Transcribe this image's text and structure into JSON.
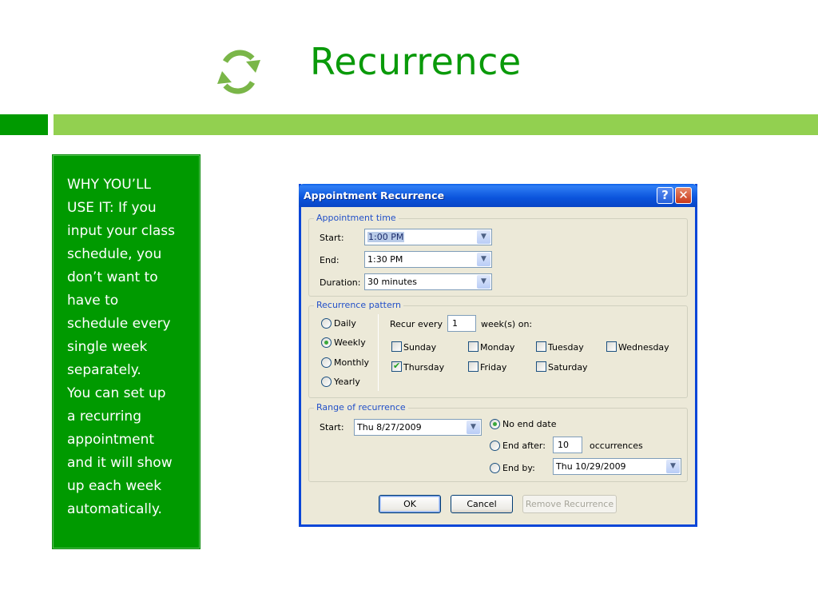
{
  "slide": {
    "title": "Recurrence",
    "title_icon": "recurrence-cycle-icon",
    "colors": {
      "title": "#0a9a0a",
      "bar_dark": "#009a00",
      "bar_light": "#92d050",
      "box": "#009a00"
    },
    "why_box_text": "WHY YOU’LL\nUSE IT: If you\ninput your class\nschedule, you\ndon’t want to\nhave to\nschedule every\nsingle week\nseparately.\nYou can set up\na recurring\nappointment\nand it will show\nup each week\nautomatically."
  },
  "dialog": {
    "title": "Appointment Recurrence",
    "help_label": "?",
    "close_label": "✕",
    "appointment_time": {
      "legend": "Appointment time",
      "start_label": "Start:",
      "start_value": "1:00 PM",
      "end_label": "End:",
      "end_value": "1:30 PM",
      "duration_label": "Duration:",
      "duration_value": "30 minutes"
    },
    "recurrence_pattern": {
      "legend": "Recurrence pattern",
      "options": [
        {
          "label": "Daily",
          "selected": false
        },
        {
          "label": "Weekly",
          "selected": true
        },
        {
          "label": "Monthly",
          "selected": false
        },
        {
          "label": "Yearly",
          "selected": false
        }
      ],
      "recur_every_label": "Recur every",
      "recur_every_value": "1",
      "weeks_on_label": "week(s) on:",
      "days": [
        {
          "label": "Sunday",
          "checked": false
        },
        {
          "label": "Monday",
          "checked": false
        },
        {
          "label": "Tuesday",
          "checked": false
        },
        {
          "label": "Wednesday",
          "checked": false
        },
        {
          "label": "Thursday",
          "checked": true
        },
        {
          "label": "Friday",
          "checked": false
        },
        {
          "label": "Saturday",
          "checked": false
        }
      ]
    },
    "range": {
      "legend": "Range of recurrence",
      "start_label": "Start:",
      "start_value": "Thu 8/27/2009",
      "no_end_label": "No end date",
      "no_end_selected": true,
      "end_after_label": "End after:",
      "end_after_value": "10",
      "occurrences_label": "occurrences",
      "end_by_label": "End by:",
      "end_by_value": "Thu 10/29/2009"
    },
    "buttons": {
      "ok": "OK",
      "cancel": "Cancel",
      "remove": "Remove Recurrence"
    }
  }
}
